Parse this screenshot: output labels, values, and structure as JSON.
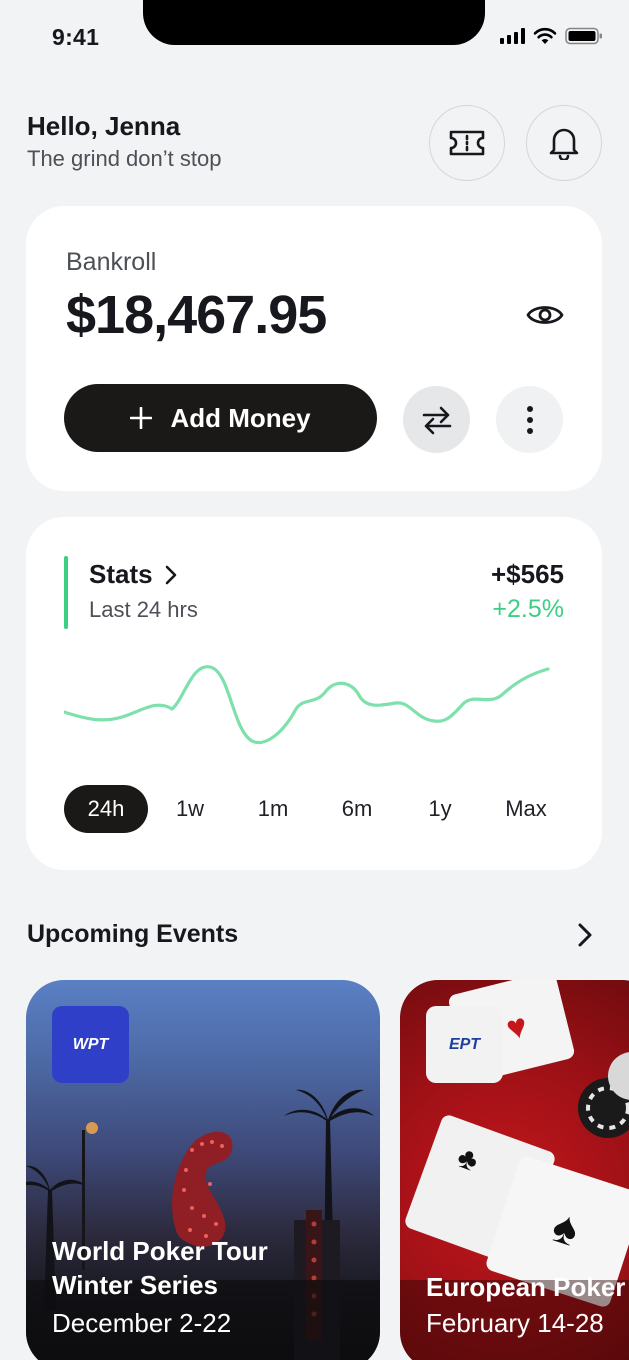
{
  "status_bar": {
    "time": "9:41"
  },
  "header": {
    "greeting": "Hello, Jenna",
    "subtitle": "The grind don’t stop"
  },
  "bankroll": {
    "label": "Bankroll",
    "amount": "$18,467.95",
    "add_money_label": "Add Money"
  },
  "stats": {
    "title": "Stats",
    "period": "Last 24 hrs",
    "change_value": "+$565",
    "change_percent": "+2.5%",
    "line_color": "#7ee0ab",
    "ranges": [
      "24h",
      "1w",
      "1m",
      "6m",
      "1y",
      "Max"
    ],
    "selected_range": "24h"
  },
  "upcoming": {
    "title": "Upcoming Events",
    "events": [
      {
        "logo_text": "WPT",
        "logo_color": "#2f3fc7",
        "name_line1": "World Poker Tour",
        "name_line2": "Winter Series",
        "dates": "December 2-22"
      },
      {
        "logo_text": "EPT",
        "logo_color": "#f2f2f2",
        "name_line1": "European Poker",
        "dates": "February 14-28"
      }
    ]
  }
}
